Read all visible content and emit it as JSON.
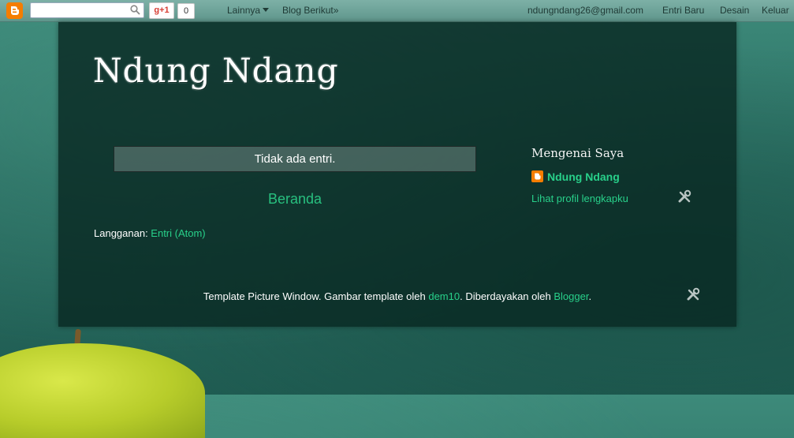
{
  "navbar": {
    "gplus_label": "g+1",
    "gplus_count": "0",
    "more_label": "Lainnya",
    "next_blog_label": "Blog Berikut»",
    "email": "ndungndang26@gmail.com",
    "new_post_label": "Entri Baru",
    "design_label": "Desain",
    "logout_label": "Keluar"
  },
  "header": {
    "title": "Ndung Ndang"
  },
  "main": {
    "no_posts_text": "Tidak ada entri.",
    "home_label": "Beranda",
    "subscribe_prefix": "Langganan: ",
    "subscribe_link": "Entri (Atom)"
  },
  "sidebar": {
    "about_title": "Mengenai Saya",
    "profile_name": "Ndung Ndang",
    "profile_link": "Lihat profil lengkapku"
  },
  "footer": {
    "text_1": "Template Picture Window. Gambar template oleh ",
    "link_1": "dem10",
    "text_2": ". Diberdayakan oleh ",
    "link_2": "Blogger",
    "text_3": "."
  },
  "colors": {
    "accent": "#28d08a",
    "blogger_orange": "#f57d00"
  }
}
